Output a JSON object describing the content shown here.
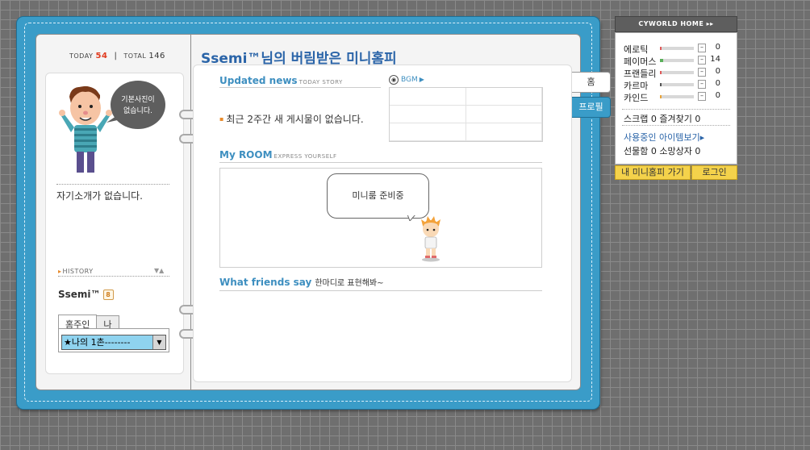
{
  "counter": {
    "today_label": "TODAY",
    "today_value": "54",
    "total_label": "TOTAL",
    "total_value": "146"
  },
  "profile": {
    "photo_bubble_line1": "기본사진이",
    "photo_bubble_line2": "없습니다.",
    "intro": "자기소개가 없습니다.",
    "history_label": "HISTORY",
    "name": "Ssemi™",
    "gender_mark": "8",
    "tabs": [
      "홈주인",
      "나"
    ],
    "select_value": "★나의 1촌--------"
  },
  "main": {
    "title": "Ssemi™님의 버림받은 미니홈피",
    "updated_news": "Updated news",
    "updated_news_sub": "TODAY STORY",
    "bgm_label": "BGM",
    "no_posts": "최근 2주간 새 게시물이 없습니다.",
    "my_room": "My ROOM",
    "my_room_sub": "EXPRESS YOURSELF",
    "room_bubble": "미니룸 준비중",
    "friends_say": "What friends say",
    "friends_say_sub": "한마디로 표현해봐~"
  },
  "side_tabs": {
    "home": "홈",
    "profile": "프로필"
  },
  "cyworld_panel": {
    "header": "CYWORLD HOME ▸▸",
    "stats": [
      {
        "label": "에로틱",
        "value": "0",
        "level": 0.0,
        "color": "#e05a5a"
      },
      {
        "label": "페이머스",
        "value": "14",
        "level": 0.1,
        "color": "#5ab05a"
      },
      {
        "label": "프랜들리",
        "value": "0",
        "level": 0.0,
        "color": "#e05a5a"
      },
      {
        "label": "카르마",
        "value": "0",
        "level": 0.0,
        "color": "#555555"
      },
      {
        "label": "카인드",
        "value": "0",
        "level": 0.0,
        "color": "#e8a33a"
      }
    ],
    "scrap": "스크랩 0 즐겨찾기 0",
    "items_link": "사용중인 아이템보기▸",
    "gift": "선물함 0 소망상자 0",
    "btn_minihome": "내 미니홈피 가기",
    "btn_login": "로그인"
  },
  "colors": {
    "cover": "#3a9cc8",
    "title": "#2a64a8",
    "section": "#3e8fc0",
    "yellow_btn": "#f4d24b"
  }
}
